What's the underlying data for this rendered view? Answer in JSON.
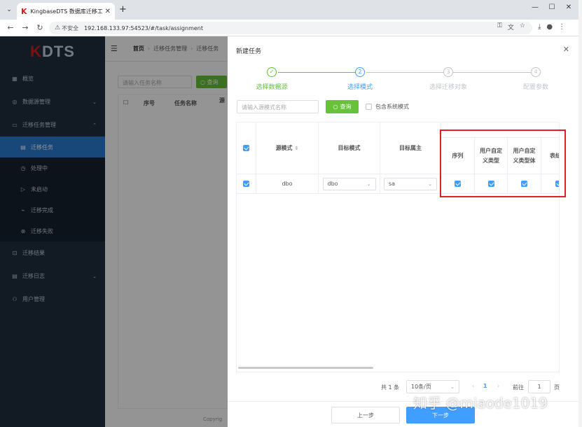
{
  "browser": {
    "tab_title": "KingbaseDTS 数据库迁移工具",
    "tab_logo": "K",
    "insecure_label": "不安全",
    "url": "192.168.133.97:54523/#/task/assignment"
  },
  "sidebar": {
    "logo_k": "K",
    "logo_rest": "DTS",
    "items": [
      {
        "label": "概览"
      },
      {
        "label": "数据源管理"
      },
      {
        "label": "迁移任务管理"
      },
      {
        "label": "迁移任务"
      },
      {
        "label": "处理中"
      },
      {
        "label": "未启动"
      },
      {
        "label": "迁移完成"
      },
      {
        "label": "迁移失败"
      },
      {
        "label": "迁移结果"
      },
      {
        "label": "迁移日志"
      },
      {
        "label": "用户管理"
      }
    ]
  },
  "background": {
    "breadcrumb_home": "首页",
    "breadcrumb_1": "迁移任务管理",
    "breadcrumb_2": "迁移任务",
    "search_placeholder": "请输入任务名称",
    "search_button": "查询",
    "col_index": "序号",
    "col_name": "任务名称",
    "col_source": "源",
    "copyright": "Copyrig"
  },
  "drawer": {
    "title": "新建任务",
    "steps": [
      {
        "label": "选择数据源",
        "state": "success",
        "icon": "✓"
      },
      {
        "label": "选择模式",
        "state": "process",
        "icon": "2"
      },
      {
        "label": "选择迁移对象",
        "state": "wait",
        "icon": "3"
      },
      {
        "label": "配置参数",
        "state": "wait",
        "icon": "4"
      }
    ],
    "search_placeholder": "请输入源模式名称",
    "search_button": "查询",
    "include_system_schema": "包含系统模式",
    "table": {
      "headers": {
        "source_schema": "源模式",
        "target_schema": "目标模式",
        "target_owner": "目标属主",
        "sequence": "序列",
        "udt": "用户自定义类型",
        "udt_body": "用户自定义类型体",
        "table": "表结"
      },
      "rows": [
        {
          "source_schema": "dbo",
          "target_schema": "dbo",
          "target_owner": "sa"
        }
      ]
    },
    "pagination": {
      "total": "共 1 条",
      "page_size": "10条/页",
      "current": "1",
      "goto": "前往",
      "goto_value": "1",
      "page_unit": "页"
    },
    "prev_button": "上一步",
    "next_button": "下一步"
  },
  "watermark": "知乎 @miaode1019"
}
